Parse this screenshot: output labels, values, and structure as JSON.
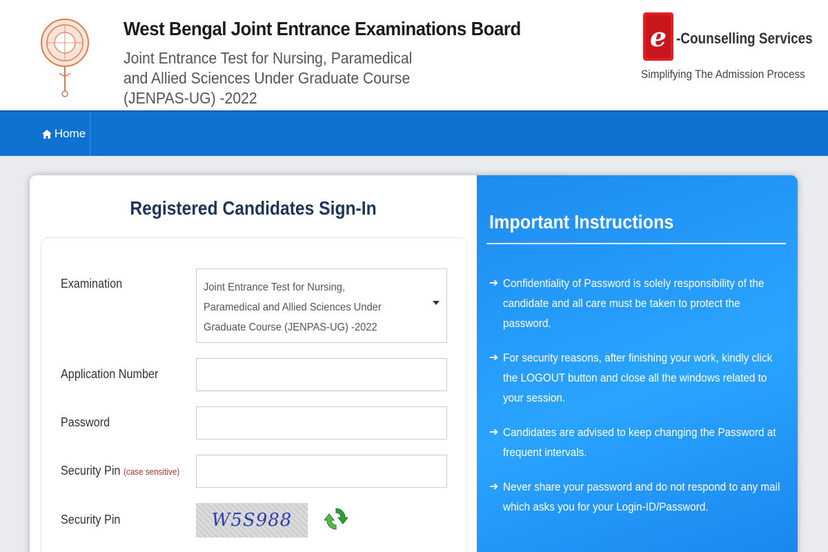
{
  "header": {
    "board_title": "West Bengal Joint Entrance Examinations Board",
    "exam_title": "Joint Entrance Test for Nursing, Paramedical and Allied Sciences Under Graduate Course (JENPAS-UG) -2022",
    "logo_icon": "wbjeeb-emblem-icon",
    "ec_brand": "-Counselling Services",
    "ec_tagline": "Simplifying The Admission Process"
  },
  "nav": {
    "home_label": "Home",
    "home_icon": "home-icon"
  },
  "signin": {
    "title": "Registered Candidates Sign-In",
    "examination_label": "Examination",
    "examination_value": "Joint Entrance Test for Nursing, Paramedical and Allied Sciences Under Graduate Course (JENPAS-UG) -2022",
    "application_label": "Application Number",
    "application_value": "",
    "password_label": "Password",
    "password_value": "",
    "pin_input_label": "Security Pin",
    "pin_input_note": "(case sensitive)",
    "pin_input_value": "",
    "captcha_label": "Security Pin",
    "captcha_text": "W5S988",
    "refresh_icon": "refresh-icon"
  },
  "instructions": {
    "title": "Important Instructions",
    "items": [
      "Confidentiality of Password is solely responsibility of the candidate and all care must be taken to protect the password.",
      "For security reasons, after finishing your work, kindly click the LOGOUT button and close all the windows related to your session.",
      "Candidates are advised to keep changing the Password at frequent intervals.",
      "Never share your password and do not respond to any mail which asks you for your Login-ID/Password."
    ]
  },
  "colors": {
    "navbar": "#0e72d1",
    "instructions_bg": "#2aa4ff",
    "title_text": "#1d3557",
    "ec_red": "#e31e24"
  }
}
